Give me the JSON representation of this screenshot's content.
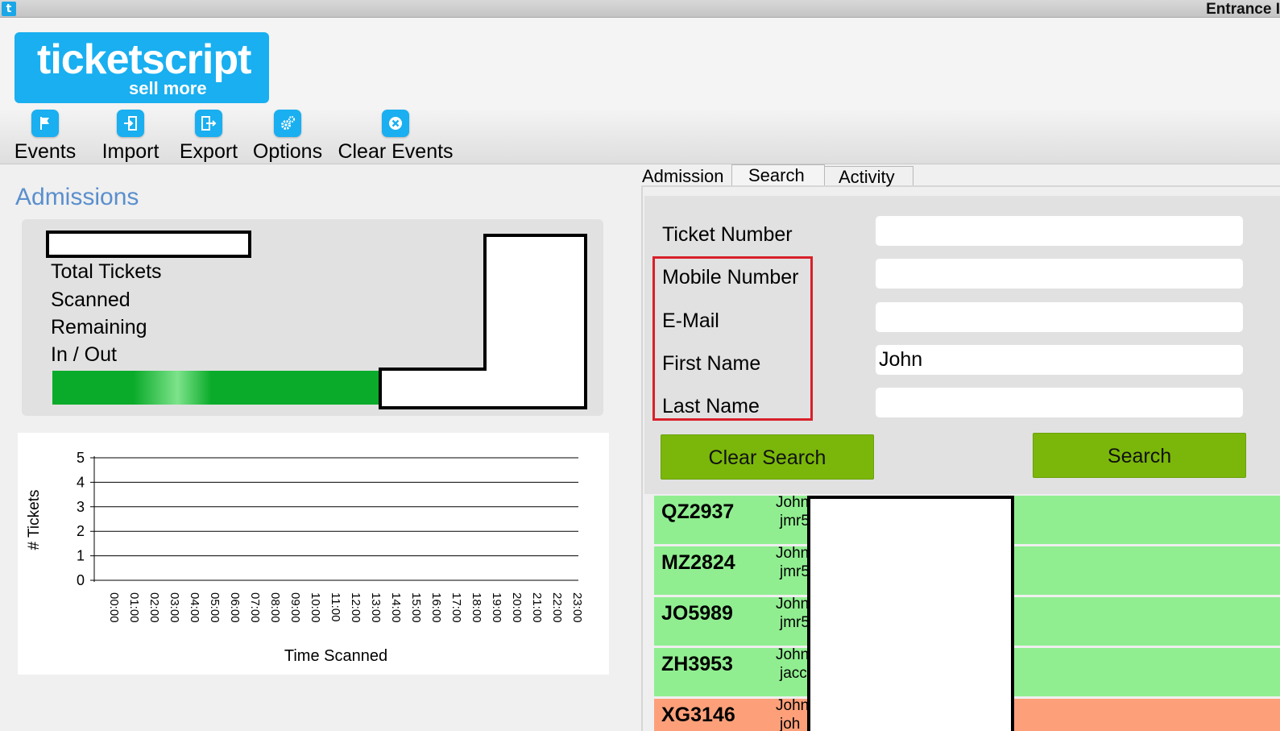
{
  "window": {
    "app_icon": "t",
    "title": "Entrance I"
  },
  "logo": {
    "brand": "ticketscript",
    "tagline": "sell more",
    "color": "#19aff0"
  },
  "toolbar": {
    "items": [
      {
        "label": "Events",
        "icon": "flag-icon"
      },
      {
        "label": "Import",
        "icon": "import-icon"
      },
      {
        "label": "Export",
        "icon": "export-icon"
      },
      {
        "label": "Options",
        "icon": "gears-icon"
      },
      {
        "label": "Clear Events",
        "icon": "clear-x-icon"
      }
    ]
  },
  "admissions": {
    "title": "Admissions",
    "labels": {
      "total_tickets": "Total Tickets",
      "scanned": "Scanned",
      "remaining": "Remaining",
      "in_out": "In / Out"
    },
    "progress_color": "#0aab2a"
  },
  "chart_data": {
    "type": "bar",
    "categories": [
      "00:00",
      "01:00",
      "02:00",
      "03:00",
      "04:00",
      "05:00",
      "06:00",
      "07:00",
      "08:00",
      "09:00",
      "10:00",
      "11:00",
      "12:00",
      "13:00",
      "14:00",
      "15:00",
      "16:00",
      "17:00",
      "18:00",
      "19:00",
      "20:00",
      "21:00",
      "22:00",
      "23:00"
    ],
    "values": [
      0,
      0,
      0,
      0,
      0,
      0,
      0,
      0,
      0,
      0,
      0,
      0,
      0,
      0,
      0,
      0,
      0,
      0,
      0,
      0,
      0,
      0,
      0,
      0
    ],
    "yticks": [
      "0",
      "1",
      "2",
      "3",
      "4",
      "5"
    ],
    "ylim": [
      0,
      5
    ],
    "xlabel": "Time Scanned",
    "ylabel": "# Tickets",
    "grid": true
  },
  "tabs": [
    {
      "label": "Admission",
      "active": false
    },
    {
      "label": "Search",
      "active": true
    },
    {
      "label": "Activity",
      "active": false
    }
  ],
  "search_form": {
    "fields": [
      {
        "label": "Ticket Number",
        "value": ""
      },
      {
        "label": "Mobile Number",
        "value": ""
      },
      {
        "label": "E-Mail",
        "value": ""
      },
      {
        "label": "First Name",
        "value": "John"
      },
      {
        "label": "Last Name",
        "value": ""
      }
    ],
    "clear_button": "Clear Search",
    "search_button": "Search",
    "button_color": "#7ab70a",
    "highlight_color": "#d9202a"
  },
  "results": [
    {
      "code": "QZ2937",
      "name": "John",
      "email": "jmr5",
      "color": "#90ee90"
    },
    {
      "code": "MZ2824",
      "name": "John",
      "email": "jmr5",
      "color": "#90ee90"
    },
    {
      "code": "JO5989",
      "name": "John",
      "email": "jmr5",
      "color": "#90ee90"
    },
    {
      "code": "ZH3953",
      "name": "John",
      "email": "jacc",
      "color": "#90ee90"
    },
    {
      "code": "XG3146",
      "name": "John",
      "email": "joh",
      "color": "#fda07a"
    }
  ]
}
